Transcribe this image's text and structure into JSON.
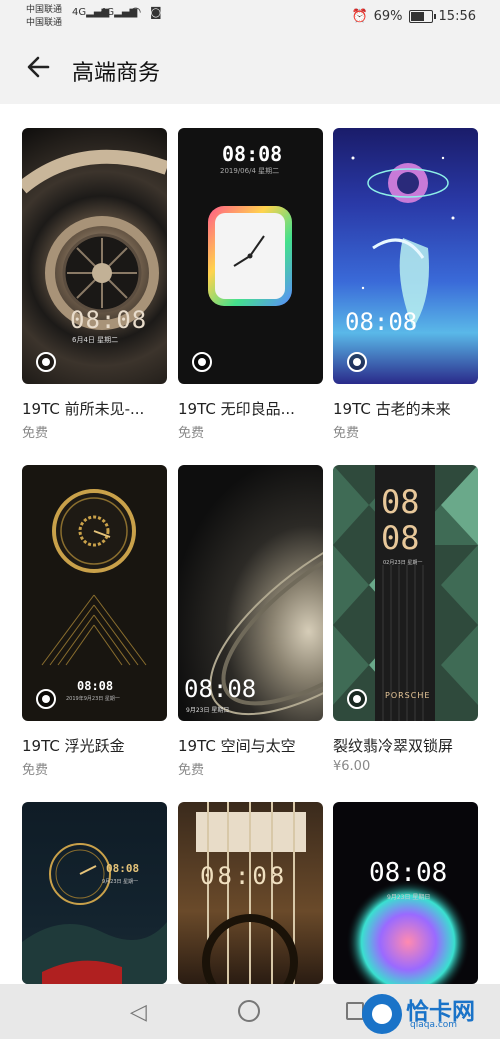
{
  "status": {
    "carrier1": "中国联通",
    "carrier2": "中国联通",
    "net1": "4G",
    "net2": "4G",
    "battery": "69%",
    "battery_level": 0.69,
    "time": "15:56"
  },
  "header": {
    "title": "高端商务"
  },
  "themes": [
    {
      "name": "19TC 前所未见-...",
      "price": "免费",
      "clock": "08:08",
      "date": "6月4日 星期二"
    },
    {
      "name": "19TC 无印良品...",
      "price": "免费",
      "clock": "08:08",
      "date": "2019/06/4 星期二"
    },
    {
      "name": "19TC 古老的未来",
      "price": "免费",
      "clock": "08:08",
      "date": ""
    },
    {
      "name": "19TC 浮光跃金",
      "price": "免费",
      "clock": "08:08",
      "date": "2019年9月23日 星期一"
    },
    {
      "name": "19TC 空间与太空",
      "price": "免费",
      "clock": "08:08",
      "date": "9月23日 星期日"
    },
    {
      "name": "裂纹翡冷翠双锁屏",
      "price": "¥6.00",
      "clock": "08",
      "clock2": "08",
      "date": "02月23日 星期一",
      "brand": "PORSCHE"
    },
    {
      "name": "",
      "price": "",
      "clock": "08:08",
      "date": "9月23日 星期一"
    },
    {
      "name": "",
      "price": "",
      "clock": "08:08",
      "date": ""
    },
    {
      "name": "",
      "price": "",
      "clock": "08:08",
      "date": "9月23日 星期日"
    }
  ],
  "watermark": {
    "text": "恰卡网",
    "sub": "qiaqa.com"
  },
  "icons": {
    "back": "arrow-left-icon",
    "nav_back": "triangle-back-icon",
    "nav_home": "circle-home-icon",
    "nav_recent": "square-recent-icon"
  }
}
